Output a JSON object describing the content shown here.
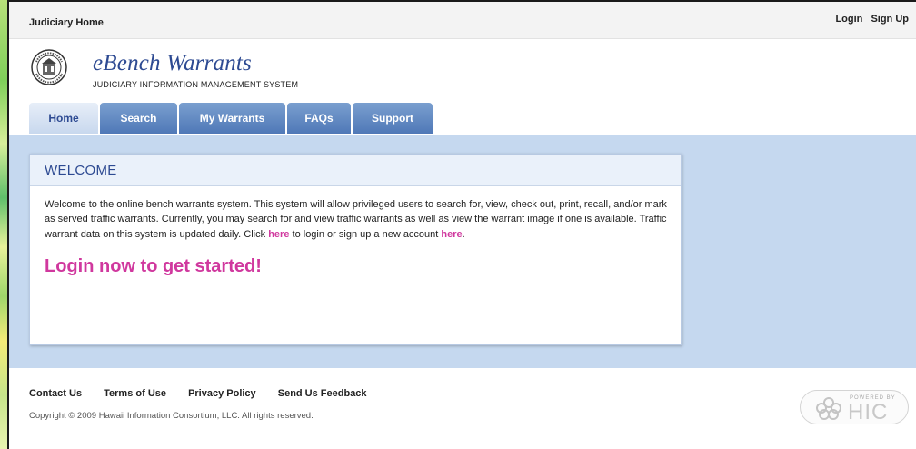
{
  "topbar": {
    "home_link": "Judiciary Home",
    "login": "Login",
    "signup": "Sign Up"
  },
  "brand": {
    "title": "eBench Warrants",
    "subtitle": "JUDICIARY INFORMATION MANAGEMENT SYSTEM",
    "seal_icon": "state-seal-icon"
  },
  "tabs": [
    {
      "label": "Home",
      "active": true
    },
    {
      "label": "Search",
      "active": false
    },
    {
      "label": "My Warrants",
      "active": false
    },
    {
      "label": "FAQs",
      "active": false
    },
    {
      "label": "Support",
      "active": false
    }
  ],
  "welcome": {
    "heading": "WELCOME",
    "body_1": "Welcome to the online bench warrants system. This system will allow privileged users to search for, view, check out, print, recall, and/or mark as served traffic warrants. Currently, you may search for and view traffic warrants as well as view the warrant image if one is available. Traffic warrant data on this system is updated daily. Click",
    "link_1": "here",
    "body_2": "to login or sign up a new account",
    "link_2": "here",
    "body_3": ".",
    "cta": "Login now to get started!"
  },
  "footer": {
    "links": [
      "Contact Us",
      "Terms of Use",
      "Privacy Policy",
      "Send Us Feedback"
    ],
    "copyright": "Copyright © 2009 Hawaii Information Consortium, LLC. All rights reserved.",
    "powered_by": "POWERED BY",
    "hic": "HIC"
  },
  "colors": {
    "brand_blue": "#2d4a92",
    "tab_blue": "#4f78b7",
    "band_blue": "#c5d8ef",
    "link_pink": "#d0389e"
  }
}
